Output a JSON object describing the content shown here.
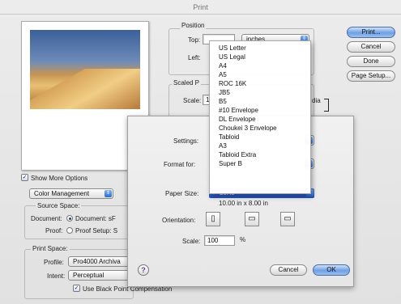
{
  "window": {
    "title": "Print"
  },
  "buttons": {
    "print": "Print...",
    "cancel": "Cancel",
    "done": "Done",
    "page_setup": "Page Setup..."
  },
  "position": {
    "label": "Position",
    "top_label": "Top:",
    "top_value": "",
    "units": "inches",
    "left_label": "Left:"
  },
  "scaled": {
    "label": "Scaled P",
    "scale_label": "Scale:",
    "scale_value": "1",
    "media_text": "dia"
  },
  "show_more": {
    "label": "Show More Options",
    "checked": true
  },
  "color_management": {
    "value": "Color Management"
  },
  "source_space": {
    "label": "Source Space:",
    "document_label": "Document:",
    "document_option": "Document: sF",
    "proof_label": "Proof:",
    "proof_option": "Proof Setup: S"
  },
  "print_space": {
    "label": "Print Space:",
    "profile_label": "Profile:",
    "profile_value": "Pro4000 Archiva",
    "intent_label": "Intent:",
    "intent_value": "Perceptual",
    "black_point_label": "Use Black Point Compensation",
    "black_point_checked": true
  },
  "sheet": {
    "settings_label": "Settings:",
    "format_label": "Format for:",
    "paper_size_label": "Paper Size:",
    "paper_size_value": "✓ 10X8",
    "paper_dims": "10.00 in x 8.00 in",
    "orientation_label": "Orientation:",
    "scale_label": "Scale:",
    "scale_value": "100",
    "scale_unit": "%",
    "help": "?",
    "cancel": "Cancel",
    "ok": "OK"
  },
  "paper_menu": {
    "items": [
      "US Letter",
      "US Legal",
      "A4",
      "A5",
      "ROC 16K",
      "JB5",
      "B5",
      "#10 Envelope",
      "DL Envelope",
      "Choukei 3 Envelope",
      "Tabloid",
      "A3",
      "Tabloid Extra",
      "Super B"
    ]
  },
  "colors": {
    "accent": "#1f4fbf",
    "button_blue": "#6f9fe3"
  },
  "icons": {
    "popup_arrows": "updown-arrows-icon",
    "orientation": [
      "portrait-icon",
      "landscape-left-icon",
      "landscape-right-icon"
    ]
  }
}
